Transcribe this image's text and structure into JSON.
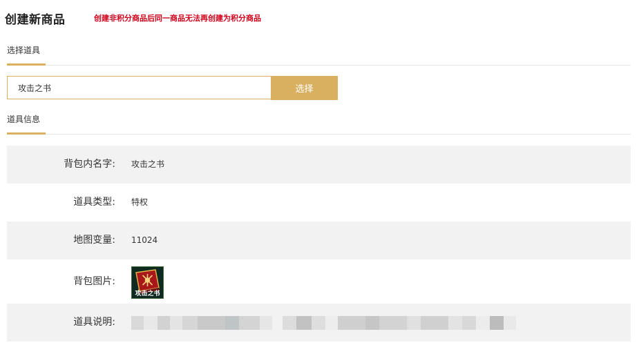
{
  "page": {
    "title": "创建新商品",
    "warning": "创建非积分商品后同一商品无法再创建为积分商品"
  },
  "select_section": {
    "tab_label": "选择道具",
    "input_value": "攻击之书",
    "button_label": "选择"
  },
  "info_section": {
    "tab_label": "道具信息",
    "rows": [
      {
        "label": "背包内名字:",
        "value": "攻击之书"
      },
      {
        "label": "道具类型:",
        "value": "特权"
      },
      {
        "label": "地图变量:",
        "value": "11024"
      },
      {
        "label": "背包图片:",
        "image_icon": "red-book-icon",
        "image_text": "攻击之书"
      },
      {
        "label": "道具说明:",
        "value": ""
      }
    ]
  },
  "colors": {
    "accent": "#d8b060",
    "warning": "#d0021b",
    "row_shade": "#f2f2f2"
  }
}
